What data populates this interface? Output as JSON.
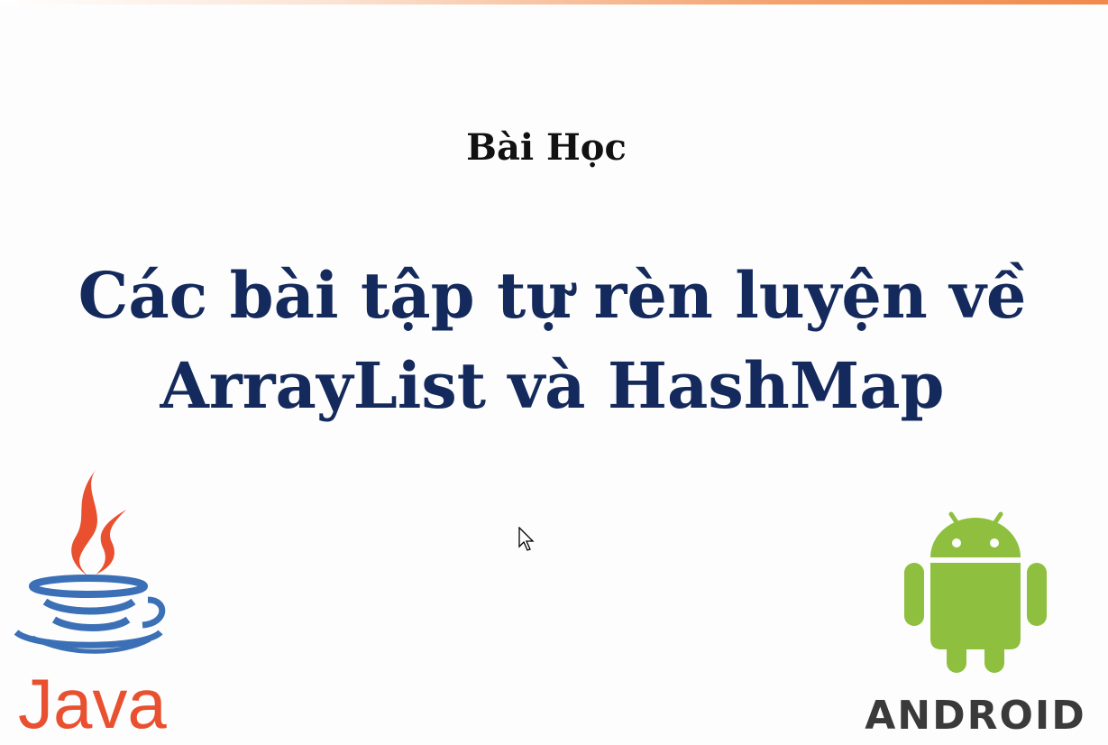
{
  "slide": {
    "subtitle": "Bài Học",
    "title_lines": [
      "Các bài tập tự rèn luyện về",
      "ArrayList và HashMap"
    ]
  },
  "logos": {
    "java": {
      "icon": "java-logo-icon",
      "wordmark": "Java",
      "flame_color": "#e8502f",
      "cup_color": "#3b6fb6"
    },
    "android": {
      "icon": "android-robot-icon",
      "wordmark": "ANDROID",
      "robot_color": "#8fbf3f",
      "wordmark_color": "#3a3a3a"
    }
  },
  "colors": {
    "title": "#142a5c",
    "subtitle": "#111111",
    "accent": "#f08a4b"
  }
}
